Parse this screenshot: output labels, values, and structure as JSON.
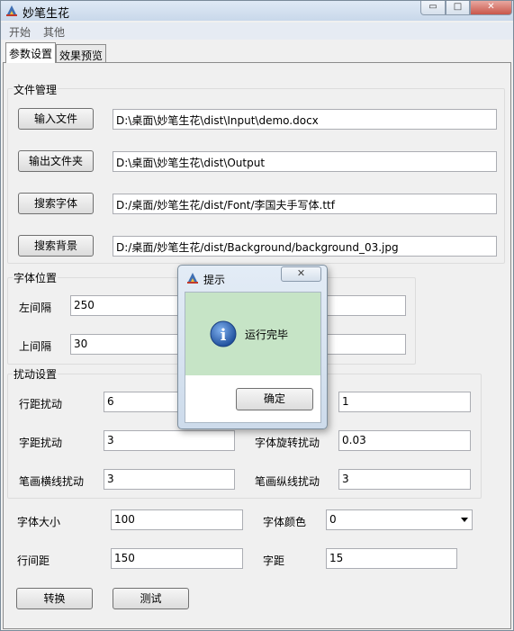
{
  "window": {
    "title": "妙笔生花",
    "minimize_glyph": "▭",
    "maximize_glyph": "□",
    "close_glyph": "✕",
    "close_color": "#c9564a"
  },
  "menu": [
    "开始",
    "其他"
  ],
  "tabs": [
    {
      "label": "参数设置",
      "active": true
    },
    {
      "label": "效果预览",
      "active": false
    }
  ],
  "file_management": {
    "title": "文件管理",
    "rows": [
      {
        "button": "输入文件",
        "value": "D:\\桌面\\妙笔生花\\dist\\Input\\demo.docx"
      },
      {
        "button": "输出文件夹",
        "value": "D:\\桌面\\妙笔生花\\dist\\Output"
      },
      {
        "button": "搜索字体",
        "value": "D:/桌面/妙笔生花/dist/Font/李国夫手写体.ttf"
      },
      {
        "button": "搜索背景",
        "value": "D:/桌面/妙笔生花/dist/Background/background_03.jpg"
      }
    ]
  },
  "font_position": {
    "title": "字体位置",
    "left_margin_label": "左间隔",
    "left_margin_value": "250",
    "top_margin_label": "上间隔",
    "top_margin_value": "30"
  },
  "perturbation": {
    "title": "扰动设置",
    "line_spacing_label": "行距扰动",
    "line_spacing_value": "6",
    "right_top_value": "1",
    "char_spacing_label": "字距扰动",
    "char_spacing_value": "3",
    "rotation_label": "字体旋转扰动",
    "rotation_value": "0.03",
    "horizontal_stroke_label": "笔画横线扰动",
    "horizontal_stroke_value": "3",
    "vertical_stroke_label": "笔画纵线扰动",
    "vertical_stroke_value": "3"
  },
  "misc": {
    "font_size_label": "字体大小",
    "font_size_value": "100",
    "font_color_label": "字体颜色",
    "font_color_value": "0",
    "line_height_label": "行间距",
    "line_height_value": "150",
    "char_distance_label": "字距",
    "char_distance_value": "15"
  },
  "actions": {
    "convert": "转换",
    "test": "测试"
  },
  "dialog": {
    "title": "提示",
    "close_glyph": "✕",
    "info_glyph": "i",
    "message": "运行完毕",
    "ok": "确定",
    "message_bg": "#c6e4c6",
    "info_color": "#2a63b8"
  }
}
